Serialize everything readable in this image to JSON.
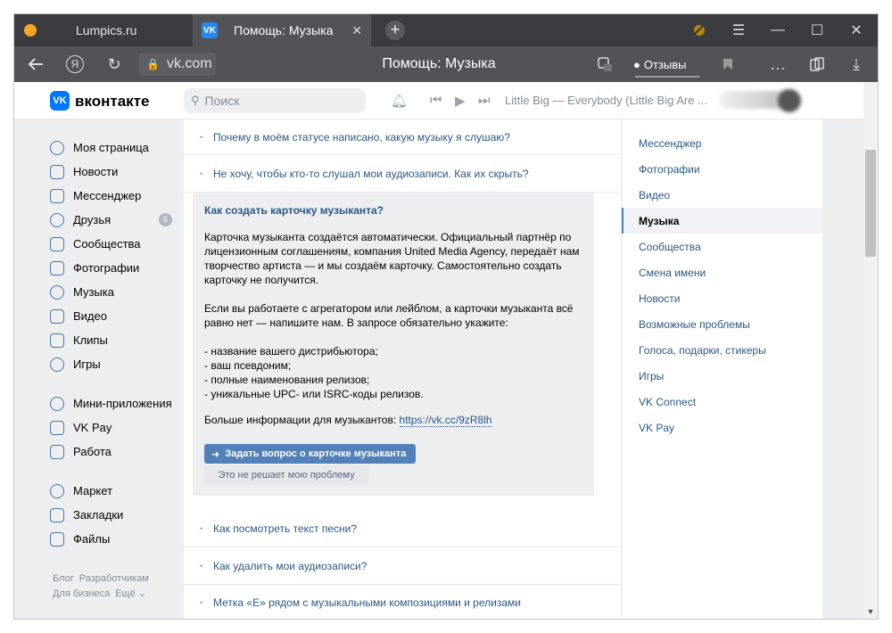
{
  "browser": {
    "tabs": [
      {
        "title": "Lumpics.ru"
      },
      {
        "title": "Помощь: Музыка",
        "favicon": "VK"
      }
    ],
    "url": "vk.com",
    "page_title": "Помощь: Музыка",
    "reviews_label": "Отзывы",
    "icons": {
      "new_tab": "plus",
      "close_tab": "✕",
      "back": "arrow-left",
      "yandex": "Я",
      "reload": "↻",
      "minimize": "—",
      "maximize": "☐",
      "close": "✕",
      "menu": "☰",
      "more": "…",
      "download": "⤓"
    }
  },
  "vk": {
    "brand": "вконтакте",
    "logo_text": "VK",
    "search_placeholder": "Поиск",
    "player_track": "Little Big — Everybody (Little Big Are ..."
  },
  "left_nav": {
    "groups": [
      [
        {
          "label": "Моя страница",
          "icon": "user-icon"
        },
        {
          "label": "Новости",
          "icon": "news-icon"
        },
        {
          "label": "Мессенджер",
          "icon": "chat-icon"
        },
        {
          "label": "Друзья",
          "icon": "friends-icon",
          "badge": "5"
        },
        {
          "label": "Сообщества",
          "icon": "groups-icon"
        },
        {
          "label": "Фотографии",
          "icon": "photo-icon"
        },
        {
          "label": "Музыка",
          "icon": "music-icon"
        },
        {
          "label": "Видео",
          "icon": "video-icon"
        },
        {
          "label": "Клипы",
          "icon": "clips-icon"
        },
        {
          "label": "Игры",
          "icon": "games-icon"
        }
      ],
      [
        {
          "label": "Мини-приложения",
          "icon": "apps-icon"
        },
        {
          "label": "VK Pay",
          "icon": "vkpay-icon"
        },
        {
          "label": "Работа",
          "icon": "work-icon"
        }
      ],
      [
        {
          "label": "Маркет",
          "icon": "market-icon"
        },
        {
          "label": "Закладки",
          "icon": "star-icon"
        },
        {
          "label": "Файлы",
          "icon": "files-icon"
        }
      ]
    ],
    "footer": [
      "Блог",
      "Разработчикам",
      "Для бизнеса",
      "Ещё ⌄"
    ]
  },
  "faq": {
    "before": [
      "Почему в моём статусе написано, какую музыку я слушаю?",
      "Не хочу, чтобы кто-то слушал мои аудиозаписи. Как их скрыть?"
    ],
    "expanded": {
      "title": "Как создать карточку музыканта?",
      "paragraph1": "Карточка музыканта создаётся автоматически. Официальный партнёр по лицензионным соглашениям, компания United Media Agency, передаёт нам творчество артиста — и мы создаём карточку. Самостоятельно создать карточку не получится.",
      "paragraph2": "Если вы работаете с агрегатором или лейблом, а карточки музыканта всё равно нет — напишите нам. В запросе обязательно укажите:",
      "list": [
        "- название вашего дистрибьютора;",
        "- ваш псевдоним;",
        "- полные наименования релизов;",
        "- уникальные UPC- или ISRC-коды релизов."
      ],
      "more_prefix": "Больше информации для музыкантов:",
      "more_link": "https://vk.cc/9zR8lh",
      "ask_button": "Задать вопрос о карточке музыканта",
      "not_solve_button": "Это не решает мою проблему"
    },
    "after": [
      "Как посмотреть текст песни?",
      "Как удалить мои аудиозаписи?",
      "Метка «E» рядом с музыкальными композициями и релизами"
    ]
  },
  "right_nav": {
    "items": [
      "Мессенджер",
      "Фотографии",
      "Видео",
      "Музыка",
      "Сообщества",
      "Смена имени",
      "Новости",
      "Возможные проблемы",
      "Голоса, подарки, стикеры",
      "Игры",
      "VK Connect",
      "VK Pay"
    ],
    "active": "Музыка"
  }
}
